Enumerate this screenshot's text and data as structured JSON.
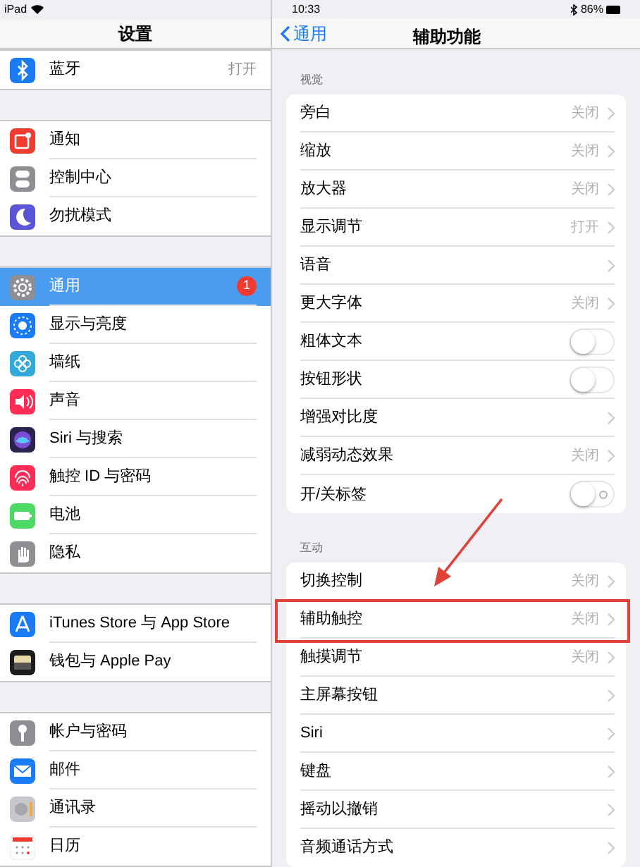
{
  "status_bar": {
    "device": "iPad",
    "time": "10:33",
    "battery": "86%"
  },
  "sidebar": {
    "title": "设置",
    "groups": [
      [
        {
          "label": "蓝牙",
          "value": "打开",
          "selected": false
        }
      ],
      [
        {
          "label": "通知",
          "selected": false
        },
        {
          "label": "控制中心",
          "selected": false
        },
        {
          "label": "勿扰模式",
          "selected": false
        }
      ],
      [
        {
          "label": "通用",
          "badge": "1",
          "selected": true
        },
        {
          "label": "显示与亮度",
          "selected": false
        },
        {
          "label": "墙纸",
          "selected": false
        },
        {
          "label": "声音",
          "selected": false
        },
        {
          "label": "Siri 与搜索",
          "selected": false
        },
        {
          "label": "触控 ID 与密码",
          "selected": false
        },
        {
          "label": "电池",
          "selected": false
        },
        {
          "label": "隐私",
          "selected": false
        }
      ],
      [
        {
          "label": "iTunes Store 与 App Store",
          "selected": false
        },
        {
          "label": "钱包与 Apple Pay",
          "selected": false
        }
      ],
      [
        {
          "label": "帐户与密码",
          "selected": false
        },
        {
          "label": "邮件",
          "selected": false
        },
        {
          "label": "通讯录",
          "selected": false
        },
        {
          "label": "日历",
          "selected": false
        }
      ]
    ]
  },
  "detail": {
    "back": "通用",
    "title": "辅助功能",
    "sections": [
      {
        "header": "视觉",
        "rows": [
          {
            "kind": "link",
            "label": "旁白",
            "value": "关闭"
          },
          {
            "kind": "link",
            "label": "缩放",
            "value": "关闭"
          },
          {
            "kind": "link",
            "label": "放大器",
            "value": "关闭"
          },
          {
            "kind": "link",
            "label": "显示调节",
            "value": "打开"
          },
          {
            "kind": "link",
            "label": "语音"
          },
          {
            "kind": "link",
            "label": "更大字体",
            "value": "关闭"
          },
          {
            "kind": "toggle",
            "label": "粗体文本",
            "on": false
          },
          {
            "kind": "toggle",
            "label": "按钮形状",
            "on": false
          },
          {
            "kind": "link",
            "label": "增强对比度"
          },
          {
            "kind": "link",
            "label": "减弱动态效果",
            "value": "关闭"
          },
          {
            "kind": "toggle",
            "label": "开/关标签",
            "on": false,
            "shows_off_label": true
          }
        ]
      },
      {
        "header": "互动",
        "rows": [
          {
            "kind": "link",
            "label": "切换控制",
            "value": "关闭"
          },
          {
            "kind": "link",
            "label": "辅助触控",
            "value": "关闭",
            "highlighted": true
          },
          {
            "kind": "link",
            "label": "触摸调节",
            "value": "关闭"
          },
          {
            "kind": "link",
            "label": "主屏幕按钮"
          },
          {
            "kind": "link",
            "label": "Siri"
          },
          {
            "kind": "link",
            "label": "键盘"
          },
          {
            "kind": "link",
            "label": "摇动以撤销"
          },
          {
            "kind": "link",
            "label": "音频通话方式"
          }
        ]
      }
    ]
  }
}
